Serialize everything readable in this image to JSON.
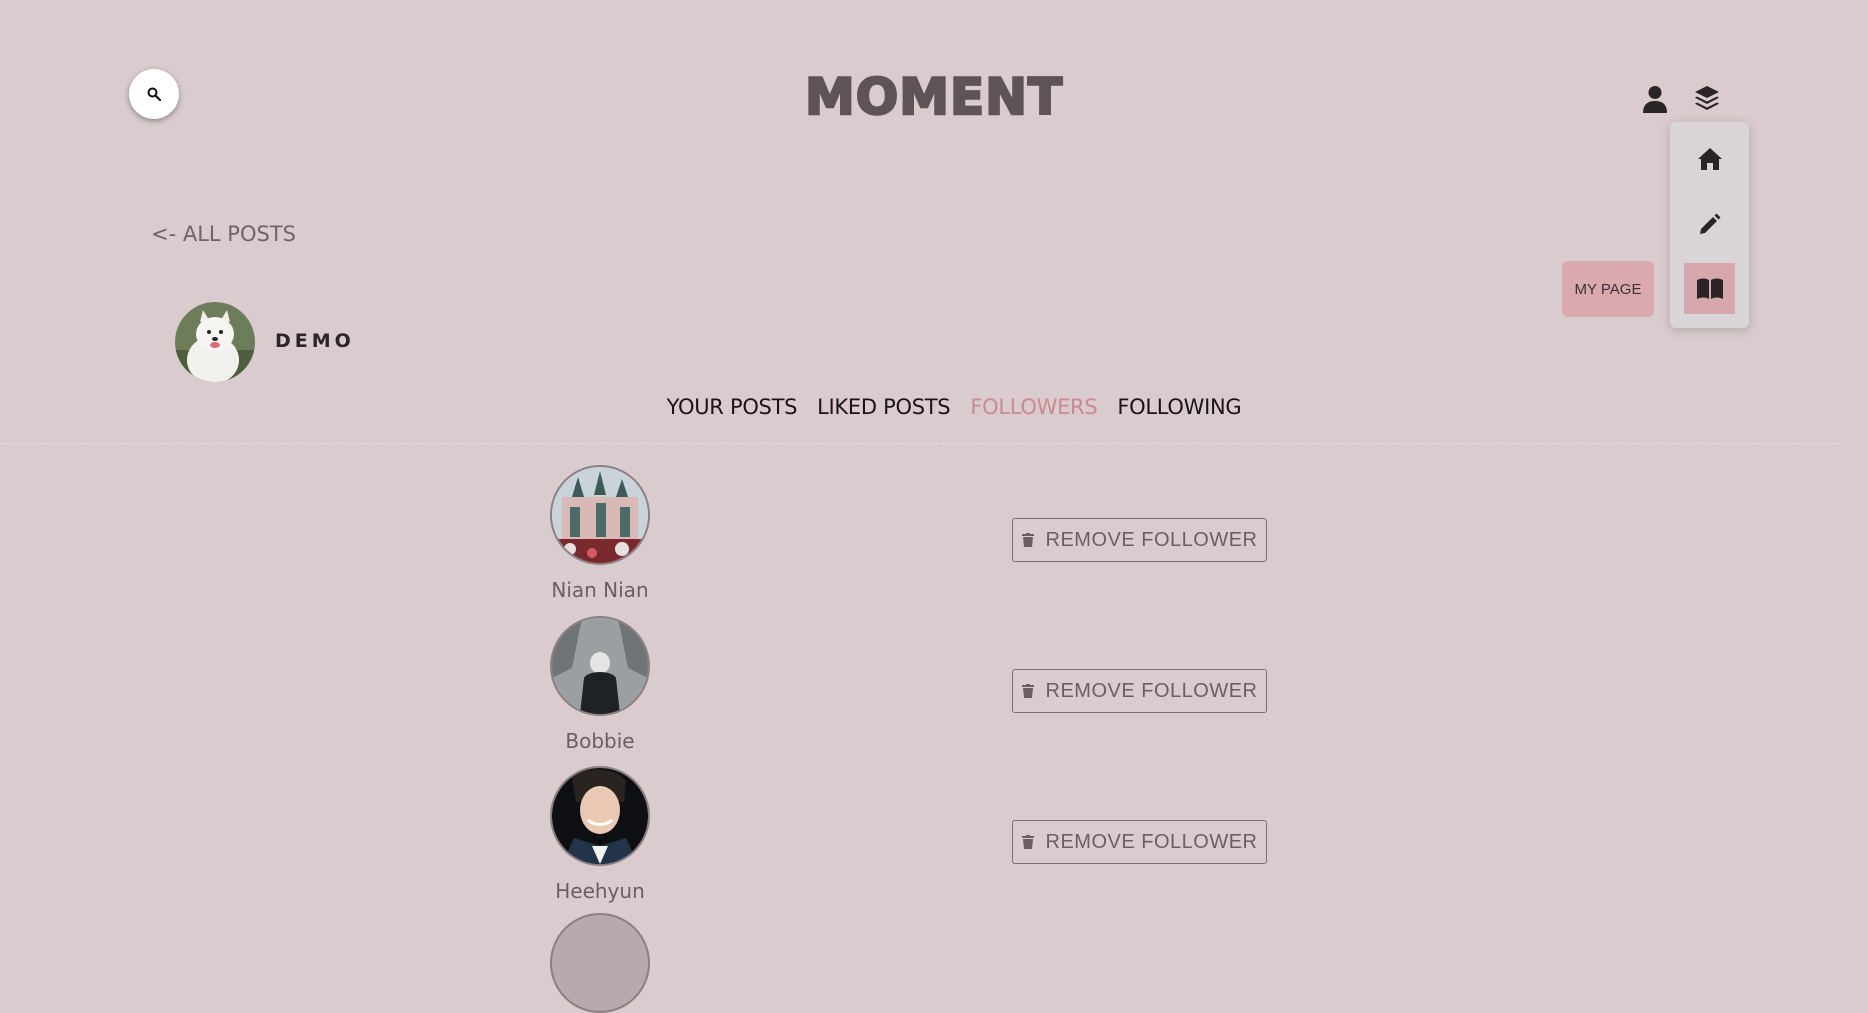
{
  "header": {
    "logo": "MOMENT",
    "search_icon": "search-icon",
    "user_icon": "user-icon",
    "menu_icon": "layers-icon"
  },
  "menu": {
    "items": [
      {
        "icon": "home-icon"
      },
      {
        "icon": "pencil-icon"
      },
      {
        "icon": "book-icon",
        "active": true
      }
    ],
    "tooltip": "MY PAGE"
  },
  "back_link": "<- ALL POSTS",
  "profile": {
    "name": "DEMO"
  },
  "tabs": [
    {
      "label": "YOUR POSTS",
      "active": false
    },
    {
      "label": "LIKED POSTS",
      "active": false
    },
    {
      "label": "FOLLOWERS",
      "active": true
    },
    {
      "label": "FOLLOWING",
      "active": false
    }
  ],
  "followers": [
    {
      "name": "Nian Nian",
      "button": "REMOVE FOLLOWER"
    },
    {
      "name": "Bobbie",
      "button": "REMOVE FOLLOWER"
    },
    {
      "name": "Heehyun",
      "button": "REMOVE FOLLOWER"
    }
  ],
  "colors": {
    "background": "#d9cbce",
    "accent": "#c98a91",
    "active_menu": "#d6a7ad"
  }
}
